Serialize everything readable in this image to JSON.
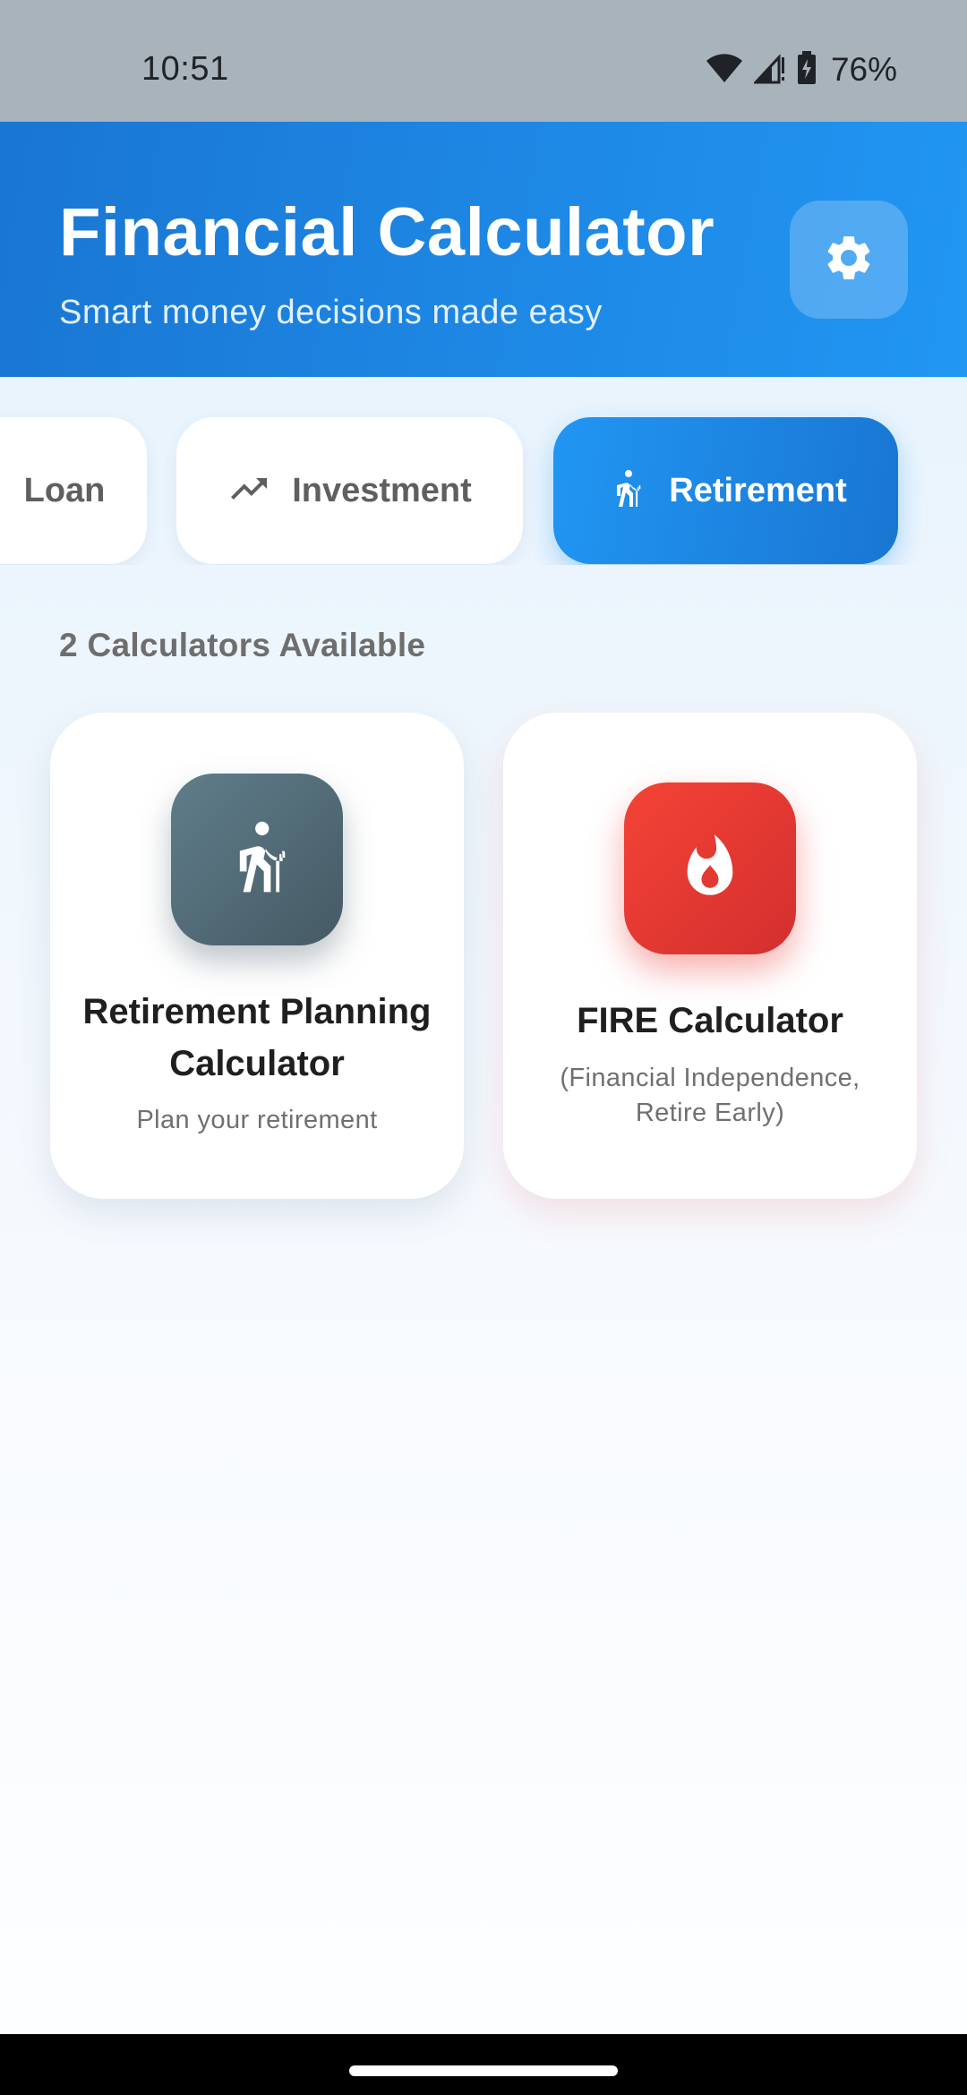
{
  "status_bar": {
    "time": "10:51",
    "battery": "76%",
    "icons": [
      "wifi-icon",
      "cell-signal-icon",
      "battery-charging-icon"
    ]
  },
  "header": {
    "title": "Financial Calculator",
    "subtitle": "Smart money decisions made easy",
    "settings_icon": "gear-icon"
  },
  "categories": [
    {
      "label": "Loan",
      "icon": "",
      "active": false
    },
    {
      "label": "Investment",
      "icon": "trending-up-icon",
      "active": false
    },
    {
      "label": "Retirement",
      "icon": "elderly-person-icon",
      "active": true
    }
  ],
  "section": {
    "count_label": "2 Calculators Available"
  },
  "calculators": [
    {
      "title_line1": "Retirement Planning",
      "title_line2": "Calculator",
      "description": "Plan your retirement",
      "icon": "elderly-person-icon",
      "color": "#546e7a"
    },
    {
      "title_line1": "FIRE Calculator",
      "description_line1": "(Financial Independence,",
      "description_line2": "Retire Early)",
      "icon": "flame-icon",
      "color": "#e53935"
    }
  ],
  "colors": {
    "primary": "#1e88e5",
    "accent_red": "#e53935",
    "slate": "#546e7a"
  }
}
